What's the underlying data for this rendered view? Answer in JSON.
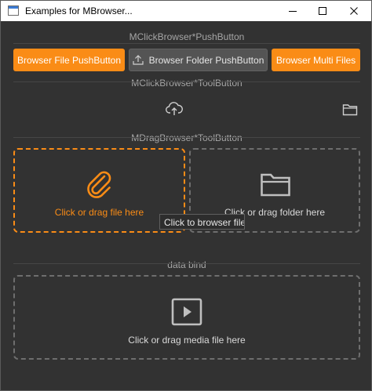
{
  "window": {
    "title": "Examples for MBrowser..."
  },
  "sections": {
    "push_button": "MClickBrowser*PushButton",
    "tool_button": "MClickBrowser*ToolButton",
    "drag_tool_button": "MDragBrowser*ToolButton",
    "data_bind": "data bind"
  },
  "push_buttons": {
    "file": "Browser File PushButton",
    "folder": "Browser Folder PushButton",
    "multi": "Browser Multi Files"
  },
  "drop_zones": {
    "file": "Click or drag file here",
    "folder": "Click or drag folder here",
    "media": "Click or drag media file here"
  },
  "tooltip": "Click to browser file",
  "colors": {
    "accent": "#fa8c16",
    "background": "#323232",
    "dashed_border": "#6e6e6e",
    "text": "#d9d9d9",
    "muted_text": "#a6a6a6"
  },
  "icons": {
    "upload_tool": "cloud-upload-icon",
    "folder_tool": "folder-icon",
    "file_zone": "paperclip-icon",
    "folder_zone": "folder-icon",
    "media_zone": "media-play-icon"
  }
}
